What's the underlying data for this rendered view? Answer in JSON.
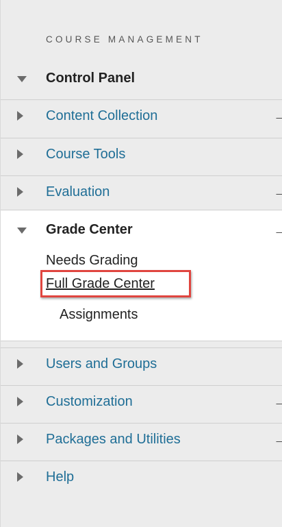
{
  "course_menu": {
    "section_title": "COURSE MANAGEMENT",
    "control_panel": {
      "label": "Control Panel",
      "expanded": true
    },
    "items": [
      {
        "label": "Content Collection",
        "has_arrow": true
      },
      {
        "label": "Course Tools",
        "has_arrow": false
      },
      {
        "label": "Evaluation",
        "has_arrow": true
      }
    ],
    "grade_center": {
      "label": "Grade Center",
      "expanded": true,
      "has_arrow": true,
      "children": {
        "needs_grading": "Needs Grading",
        "full_grade_center": "Full Grade Center",
        "assignments": "Assignments"
      }
    },
    "items_after": [
      {
        "label": "Users and Groups",
        "has_arrow": false
      },
      {
        "label": "Customization",
        "has_arrow": true
      },
      {
        "label": "Packages and Utilities",
        "has_arrow": true
      },
      {
        "label": "Help",
        "has_arrow": false
      }
    ],
    "arrow_glyph": "→",
    "highlight_color": "#e0453f",
    "link_color": "#1f6e96"
  }
}
